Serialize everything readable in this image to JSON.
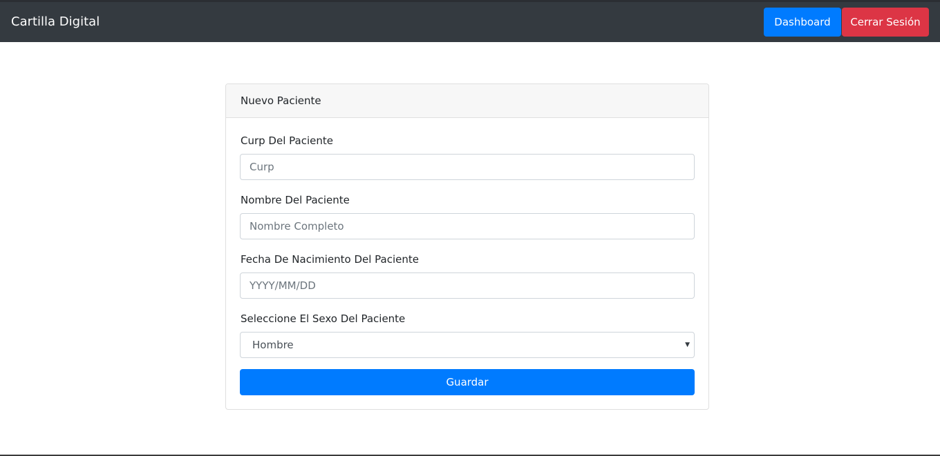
{
  "navbar": {
    "brand": "Cartilla Digital",
    "dashboard_label": "Dashboard",
    "logout_label": "Cerrar Sesión"
  },
  "form": {
    "title": "Nuevo Paciente",
    "curp": {
      "label": "Curp Del Paciente",
      "placeholder": "Curp",
      "value": ""
    },
    "name": {
      "label": "Nombre Del Paciente",
      "placeholder": "Nombre Completo",
      "value": ""
    },
    "birthdate": {
      "label": "Fecha De Nacimiento Del Paciente",
      "placeholder": "YYYY/MM/DD",
      "value": ""
    },
    "sex": {
      "label": "Seleccione El Sexo Del Paciente",
      "selected": "Hombre"
    },
    "submit_label": "Guardar"
  },
  "colors": {
    "navbar_bg": "#343a40",
    "primary": "#007bff",
    "danger": "#dc3545"
  }
}
